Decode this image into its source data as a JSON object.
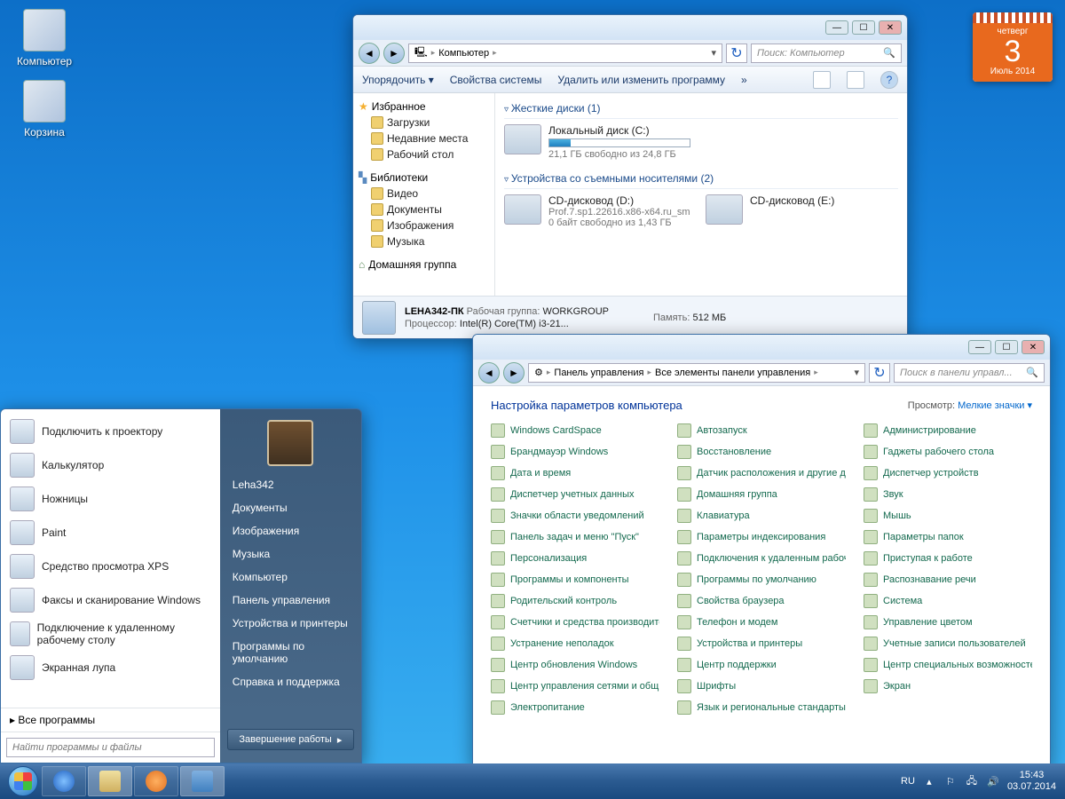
{
  "desktop": {
    "icons": [
      {
        "label": "Компьютер"
      },
      {
        "label": "Корзина"
      }
    ]
  },
  "calendar": {
    "dow": "четверг",
    "day": "3",
    "month_year": "Июль 2014"
  },
  "explorer": {
    "breadcrumb_root": "Компьютер",
    "search_placeholder": "Поиск: Компьютер",
    "toolbar": {
      "organize": "Упорядочить ▾",
      "props": "Свойства системы",
      "uninstall": "Удалить или изменить программу",
      "more": "»"
    },
    "nav": {
      "favorites": "Избранное",
      "fav_items": [
        "Загрузки",
        "Недавние места",
        "Рабочий стол"
      ],
      "libraries": "Библиотеки",
      "lib_items": [
        "Видео",
        "Документы",
        "Изображения",
        "Музыка"
      ],
      "homegroup": "Домашняя группа"
    },
    "sections": {
      "hdd": "Жесткие диски (1)",
      "removable": "Устройства со съемными носителями (2)"
    },
    "drive_c": {
      "name": "Локальный диск (C:)",
      "free": "21,1 ГБ свободно из 24,8 ГБ",
      "fill_pct": 15
    },
    "drive_d": {
      "name": "CD-дисковод (D:)",
      "sub": "Prof.7.sp1.22616.x86-x64.ru_sm",
      "free": "0 байт свободно из 1,43 ГБ"
    },
    "drive_e": {
      "name": "CD-дисковод (E:)"
    },
    "details": {
      "pc": "LEHA342-ПК",
      "wg_lbl": "Рабочая группа:",
      "wg": "WORKGROUP",
      "mem_lbl": "Память:",
      "mem": "512 МБ",
      "cpu_lbl": "Процессор:",
      "cpu": "Intel(R) Core(TM) i3-21..."
    }
  },
  "cp": {
    "breadcrumb": [
      "Панель управления",
      "Все элементы панели управления"
    ],
    "search_placeholder": "Поиск в панели управл...",
    "title": "Настройка параметров компьютера",
    "view_lbl": "Просмотр:",
    "view_val": "Мелкие значки ▾",
    "items": [
      "Windows CardSpace",
      "Автозапуск",
      "Администрирование",
      "Брандмауэр Windows",
      "Восстановление",
      "Гаджеты рабочего стола",
      "Дата и время",
      "Датчик расположения и другие дат...",
      "Диспетчер устройств",
      "Диспетчер учетных данных",
      "Домашняя группа",
      "Звук",
      "Значки области уведомлений",
      "Клавиатура",
      "Мышь",
      "Панель задач и меню \"Пуск\"",
      "Параметры индексирования",
      "Параметры папок",
      "Персонализация",
      "Подключения к удаленным рабоч...",
      "Приступая к работе",
      "Программы и компоненты",
      "Программы по умолчанию",
      "Распознавание речи",
      "Родительский контроль",
      "Свойства браузера",
      "Система",
      "Счетчики и средства производите...",
      "Телефон и модем",
      "Управление цветом",
      "Устранение неполадок",
      "Устройства и принтеры",
      "Учетные записи пользователей",
      "Центр обновления Windows",
      "Центр поддержки",
      "Центр специальных возможностей",
      "Центр управления сетями и общи...",
      "Шрифты",
      "Экран",
      "Электропитание",
      "Язык и региональные стандарты"
    ]
  },
  "start": {
    "programs": [
      "Подключить к проектору",
      "Калькулятор",
      "Ножницы",
      "Paint",
      "Средство просмотра XPS",
      "Факсы и сканирование Windows",
      "Подключение к удаленному рабочему столу",
      "Экранная лупа"
    ],
    "all": "Все программы",
    "search_placeholder": "Найти программы и файлы",
    "user": "Leha342",
    "right": [
      "Документы",
      "Изображения",
      "Музыка",
      "Компьютер",
      "Панель управления",
      "Устройства и принтеры",
      "Программы по умолчанию",
      "Справка и поддержка"
    ],
    "shutdown": "Завершение работы"
  },
  "tray": {
    "lang": "RU",
    "time": "15:43",
    "date": "03.07.2014"
  }
}
